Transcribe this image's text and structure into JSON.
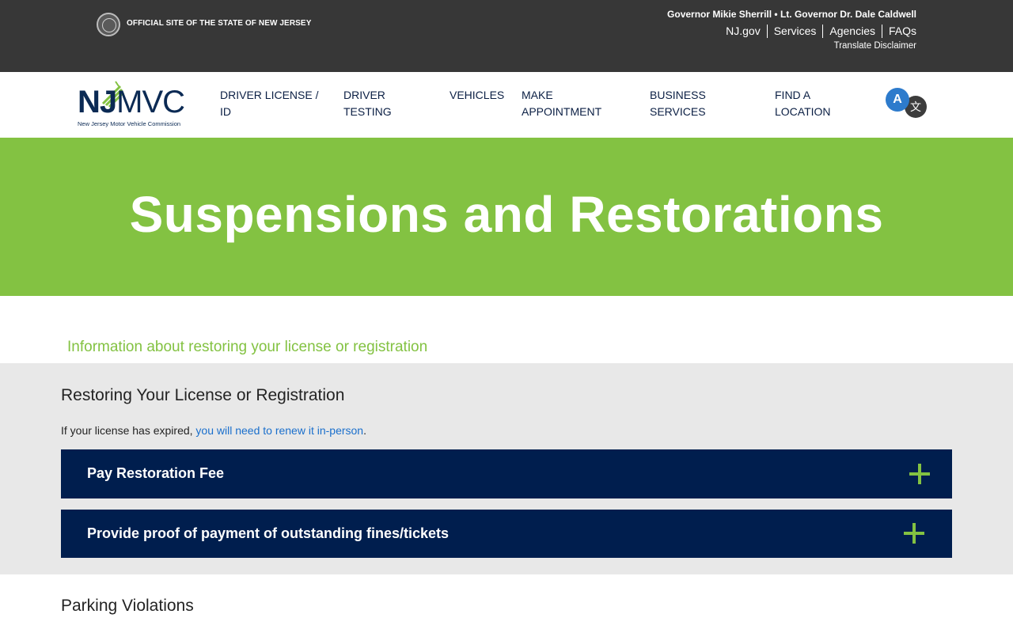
{
  "state_bar": {
    "official_label": "OFFICIAL SITE OF THE STATE OF NEW JERSEY",
    "governor": "Governor Mikie Sherrill • Lt. Governor Dr. Dale Caldwell",
    "links": [
      "NJ.gov",
      "Services",
      "Agencies",
      "FAQs"
    ],
    "translate_disclaimer": "Translate Disclaimer"
  },
  "logo": {
    "prefix": "NJ",
    "suffix": "MVC",
    "tagline": "New Jersey Motor Vehicle Commission"
  },
  "nav": {
    "items": [
      {
        "line1": "DRIVER LICENSE /",
        "line2": "ID"
      },
      {
        "line1": "DRIVER",
        "line2": "TESTING"
      },
      {
        "line1": "VEHICLES",
        "line2": ""
      },
      {
        "line1": "MAKE",
        "line2": "APPOINTMENT"
      },
      {
        "line1": "BUSINESS",
        "line2": "SERVICES"
      },
      {
        "line1": "FIND A",
        "line2": "LOCATION"
      }
    ],
    "translate_glyphs": {
      "a": "A",
      "b": "文"
    }
  },
  "hero": {
    "title": "Suspensions and Restorations"
  },
  "intro": "Information about restoring your license or registration",
  "restoring": {
    "title": "Restoring Your License or Registration",
    "text_before": "If your license has expired, ",
    "link": "you will need to renew it in-person",
    "text_after": ".",
    "accordions": [
      {
        "label": "Pay Restoration Fee"
      },
      {
        "label": "Provide proof of payment of outstanding fines/tickets"
      }
    ]
  },
  "parking": {
    "title": "Parking Violations"
  },
  "colors": {
    "green": "#83c242",
    "navy": "#001e4e",
    "dark_bar": "#373737"
  }
}
